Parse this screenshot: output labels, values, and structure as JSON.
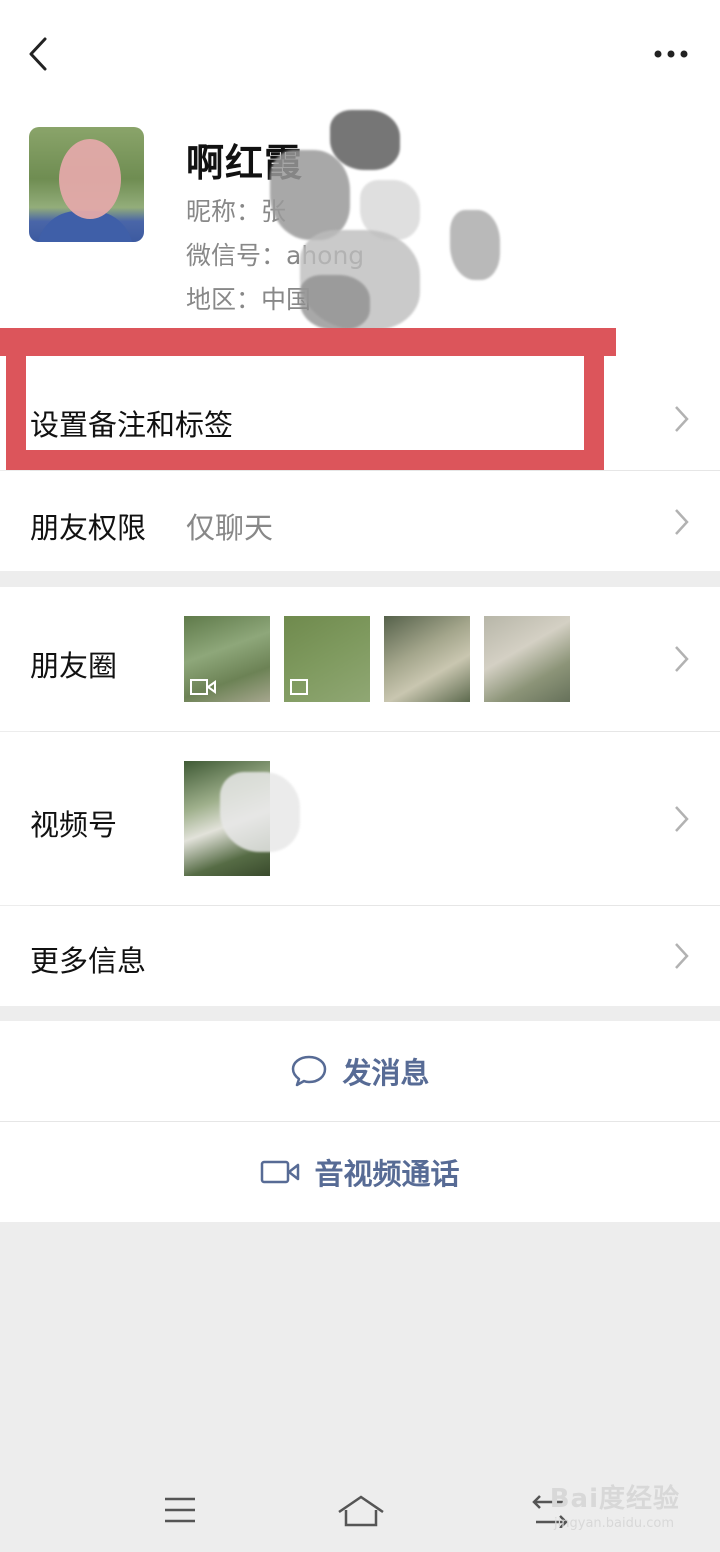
{
  "profile": {
    "name": "啊红霞",
    "nickname": "昵称：张",
    "wechat_id": "微信号：ahong",
    "region": "地区：中国"
  },
  "rows": {
    "remark": {
      "label": "设置备注和标签"
    },
    "permission": {
      "label": "朋友权限",
      "value": "仅聊天"
    },
    "moments": {
      "label": "朋友圈"
    },
    "channels": {
      "label": "视频号"
    },
    "more_info": {
      "label": "更多信息"
    }
  },
  "actions": {
    "message": {
      "label": "发消息",
      "icon": "chat-bubble-icon"
    },
    "call": {
      "label": "音视频通话",
      "icon": "video-camera-icon"
    }
  },
  "watermark": {
    "text": "Bai度经验",
    "url": "jingyan.baidu.com"
  },
  "colors": {
    "accent": "#576b95",
    "highlight": "#dc555b",
    "background": "#ededed"
  }
}
